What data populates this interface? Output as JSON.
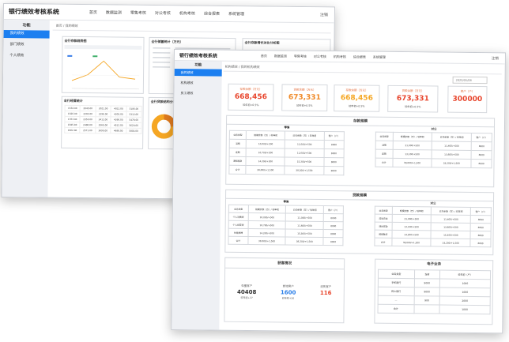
{
  "app_title": "银行绩效考核系统",
  "back": {
    "nav": [
      "首页",
      "数据监测",
      "零售考核",
      "对公考核",
      "机构考核",
      "综合报表",
      "系统管理"
    ],
    "logout": "注销",
    "sidebar_header": "功能",
    "sidebar": [
      "我的绩效",
      "部门绩效",
      "个人绩效"
    ],
    "breadcrumb": "首页 / 我的绩效",
    "panels": {
      "trend_title": "全行存款趋势图",
      "stats_title": "全行储蓄统计（万元）",
      "compare_title": "全行存款增长对比分析图",
      "table_title": "全行经营统计",
      "pie_title": "全行贷款结构分析"
    },
    "line_chart": {
      "values": [
        20,
        35,
        70,
        30,
        25
      ]
    },
    "table": {
      "rows": [
        [
          "1532.00",
          "2045.00",
          "3021.00",
          "4012.00",
          "5106.00"
        ],
        [
          "1620.00",
          "2203.00",
          "3198.00",
          "4205.00",
          "5312.00"
        ],
        [
          "1783.00",
          "2350.00",
          "3412.00",
          "4390.00",
          "5478.00"
        ],
        [
          "1845.00",
          "2480.00",
          "3560.00",
          "4512.00",
          "5620.00"
        ],
        [
          "1902.00",
          "2571.00",
          "3690.00",
          "4688.00",
          "5803.00"
        ]
      ]
    }
  },
  "front": {
    "nav": [
      "首页",
      "数据监测",
      "零售考核",
      "对公考核",
      "机构考核",
      "综合报表",
      "系统管理"
    ],
    "logout": "注销",
    "sidebar_header": "功能",
    "sidebar": [
      "我的绩效",
      "机构绩效",
      "员工绩效"
    ],
    "breadcrumb": "机构绩效 / 我的机构绩效",
    "date_field": "2020/05/08",
    "stats": [
      {
        "label": "存款余额（万元）",
        "value": "668,456",
        "sub": "较年初+0.5%",
        "color": "#e8452c"
      },
      {
        "label": "贷款余额（万元）",
        "value": "673,331",
        "sub": "较年初+0.5%",
        "color": "#f08a2a"
      },
      {
        "label": "存款余额（万元）",
        "value": "668,456",
        "sub": "较年初+0.5%",
        "color": "#f5a623"
      },
      {
        "label": "贷款余额（万元）",
        "value": "673,331",
        "sub": "较年初+0.5%",
        "color": "#e8452c"
      },
      {
        "label": "客户（户）",
        "value": "300000",
        "sub": "",
        "color": "#e8452c"
      }
    ],
    "deposit_section": {
      "title": "存款规模",
      "left_title": "零售",
      "right_title": "对公",
      "headers": [
        "业务类型",
        "规模余额（万）/ 较年初",
        "日均余额（万）/ 较年初",
        "客户（户）"
      ],
      "left_rows": [
        [
          "活期",
          "10,000/+500",
          "11,000/+500",
          "8000"
        ],
        [
          "定期",
          "10,700/+500",
          "11,600/+500",
          "8000"
        ],
        [
          "通知存款",
          "14,200/+500",
          "15,300/+500",
          "8000"
        ],
        [
          "合计",
          "38,000/+1,500",
          "38,200/+1,500",
          "8000"
        ]
      ],
      "right_rows": [
        [
          "活期",
          "21,000/+500",
          "11,400/+500",
          "8000"
        ],
        [
          "定期",
          "13,100/+500",
          "13,600/+500",
          "8000"
        ],
        [
          "合计",
          "38,000/+1,500",
          "33,200/+1,500",
          "8000"
        ]
      ]
    },
    "loan_section": {
      "title": "贷款规模",
      "left_title": "零售",
      "right_title": "对公",
      "headers": [
        "业务类型",
        "规模余额（万）/ 较年初",
        "日均余额（万）/ 较年初",
        "客户（户）"
      ],
      "left_rows": [
        [
          "个人消费贷",
          "10,000/+500",
          "11,000/+500",
          "8000"
        ],
        [
          "个人经营贷",
          "10,700/+500",
          "11,600/+500",
          "8000"
        ],
        [
          "住房按揭",
          "14,200/+500",
          "15,300/+500",
          "8000"
        ],
        [
          "合计",
          "38,000/+1,500",
          "38,200/+1,500",
          "8000"
        ]
      ],
      "right_rows": [
        [
          "流动资金",
          "21,000/+500",
          "11,400/+500",
          "8000"
        ],
        [
          "项目贷款",
          "13,100/+500",
          "13,600/+500",
          "8000"
        ],
        [
          "贸易融资",
          "14,200/+500",
          "15,300/+500",
          "8000"
        ],
        [
          "合计",
          "38,000/+1,500",
          "33,200/+1,500",
          "8000"
        ]
      ]
    },
    "customer": {
      "title": "获客情况",
      "items": [
        {
          "label": "存量客户",
          "value": "40408",
          "sub": "较年初+37",
          "color": "#333333"
        },
        {
          "label": "新增客户",
          "value": "1600",
          "sub": "较年初+26",
          "color": "#2a7ee8"
        },
        {
          "label": "流失客户",
          "value": "116",
          "sub": "",
          "color": "#e8452c"
        }
      ]
    },
    "ebank": {
      "title": "电子业务",
      "headers": [
        "业务类型",
        "当前",
        "较年初（户）"
      ],
      "rows": [
        [
          "手机银行",
          "9000",
          "1000"
        ],
        [
          "网上银行",
          "9000",
          "1000"
        ],
        [
          "—",
          " 900",
          "2000"
        ],
        [
          "合计",
          "",
          "1000"
        ]
      ]
    }
  }
}
